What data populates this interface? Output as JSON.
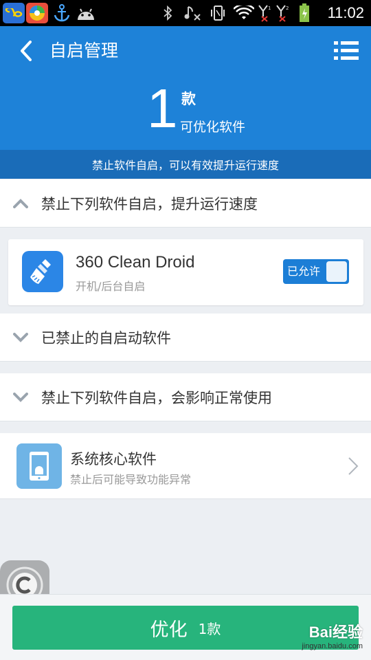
{
  "status_bar": {
    "time": "11:02",
    "app_icons": [
      "infinity-app-icon",
      "colorful-app-icon",
      "anchor-app-icon",
      "android-app-icon"
    ],
    "system_icons": [
      "bluetooth-icon",
      "music-muted-icon",
      "vibrate-icon",
      "wifi-icon",
      "signal-sim1-icon",
      "signal-sim2-icon",
      "battery-charging-icon"
    ]
  },
  "header": {
    "title": "自启管理",
    "count": "1",
    "count_unit": "款",
    "count_label": "可优化软件",
    "banner": "禁止软件自启，可以有效提升运行速度"
  },
  "sections": {
    "recommended": {
      "title": "禁止下列软件自启，提升运行速度",
      "expanded": true
    },
    "disabled": {
      "title": "已禁止的自启动软件",
      "expanded": false
    },
    "risky": {
      "title": "禁止下列软件自启，会影响正常使用",
      "expanded": false
    }
  },
  "apps": [
    {
      "name": "360 Clean Droid",
      "subtitle": "开机/后台自启",
      "toggle_label": "已允许",
      "icon": "broom-icon"
    }
  ],
  "core": {
    "title": "系统核心软件",
    "subtitle": "禁止后可能导致功能异常"
  },
  "bottom": {
    "button_label": "优化",
    "button_count": "1款"
  },
  "watermark": {
    "main": "Bai经验",
    "url": "jingyan.baidu.com"
  },
  "colors": {
    "header_blue": "#1e82d8",
    "banner_blue": "#1a6cb8",
    "accent_green": "#27b47c",
    "toggle_blue": "#1c7ed6"
  }
}
